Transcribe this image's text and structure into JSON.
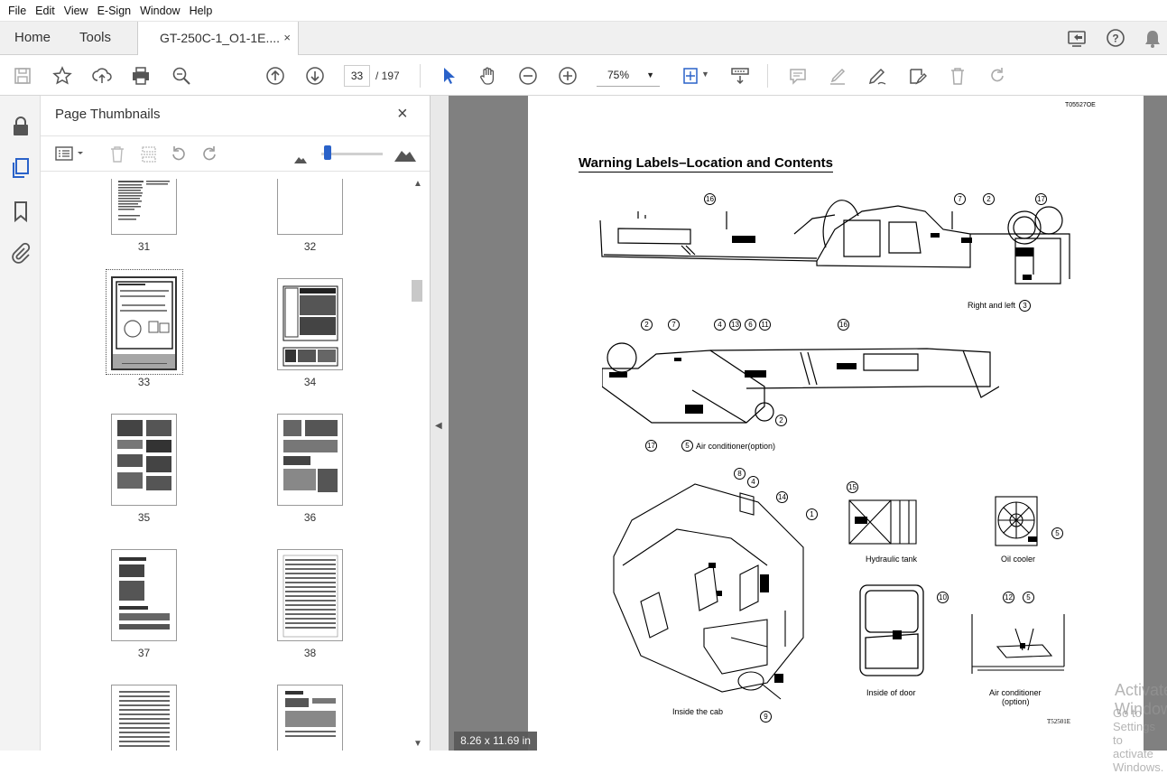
{
  "menu": [
    "File",
    "Edit",
    "View",
    "E-Sign",
    "Window",
    "Help"
  ],
  "tabs": {
    "home": "Home",
    "tools": "Tools",
    "document": "GT-250C-1_O1-1E....",
    "close": "×"
  },
  "toolbar": {
    "current_page": "33",
    "total_pages": "/ 197",
    "zoom": "75%"
  },
  "panel": {
    "title": "Page Thumbnails",
    "close": "×"
  },
  "thumbnails": [
    {
      "label": "31"
    },
    {
      "label": "32"
    },
    {
      "label": "33"
    },
    {
      "label": "34"
    },
    {
      "label": "35"
    },
    {
      "label": "36"
    },
    {
      "label": "37"
    },
    {
      "label": "38"
    }
  ],
  "page_size": "8.26 x 11.69 in",
  "document": {
    "code_top": "T05527OE",
    "heading": "Warning Labels–Location and Contents",
    "label_right_left": "Right and left",
    "label_air": "Air conditioner(option)",
    "label_hydraulic": "Hydraulic tank",
    "label_oil": "Oil cooler",
    "label_door": "Inside of door",
    "label_cab": "Inside the cab",
    "label_air2a": "Air conditioner",
    "label_air2b": "(option)",
    "code_bottom": "T52501E",
    "callouts": [
      "16",
      "7",
      "2",
      "17",
      "3",
      "2",
      "7",
      "4",
      "13",
      "6",
      "11",
      "16",
      "2",
      "17",
      "5",
      "8",
      "4",
      "14",
      "1",
      "15",
      "5",
      "10",
      "12",
      "5",
      "9"
    ]
  },
  "watermark": {
    "line1": "Activate Windows",
    "line2": "Go to Settings to activate Windows."
  }
}
